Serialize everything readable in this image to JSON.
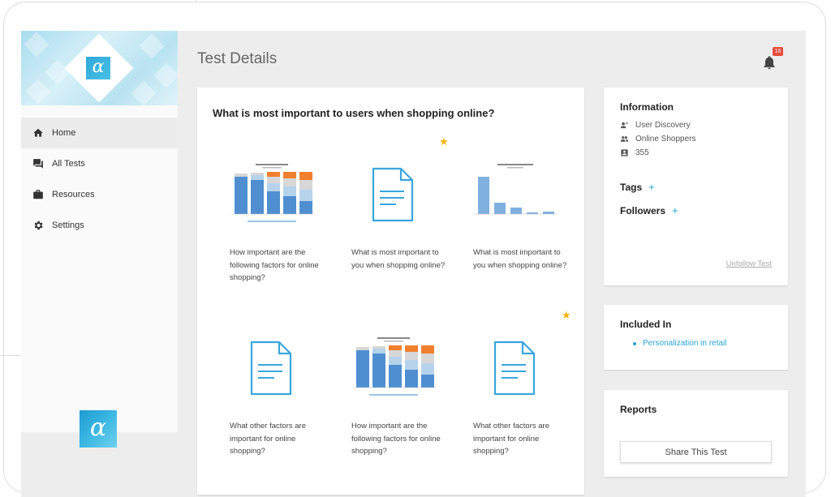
{
  "header": {
    "title": "Test Details",
    "notification_count": "16"
  },
  "sidebar": {
    "items": [
      {
        "label": "Home",
        "icon": "home-icon"
      },
      {
        "label": "All Tests",
        "icon": "chat-icon"
      },
      {
        "label": "Resources",
        "icon": "briefcase-icon"
      },
      {
        "label": "Settings",
        "icon": "gear-icon"
      }
    ],
    "logo_glyph": "α"
  },
  "main": {
    "question": "What is most important to users when shopping online?",
    "tiles": [
      {
        "caption": "How important are the following factors for online shopping?",
        "kind": "stacked-bar-chart",
        "starred": false
      },
      {
        "caption": "What is most important to you when shopping online?",
        "kind": "document",
        "starred": true
      },
      {
        "caption": "What is most important to you when shopping online?",
        "kind": "bar-chart",
        "starred": false
      },
      {
        "caption": "What other factors are important for online shopping?",
        "kind": "document",
        "starred": false
      },
      {
        "caption": "How important are the following factors for online shopping?",
        "kind": "stacked-bar-chart",
        "starred": true
      },
      {
        "caption": "What other factors are important for online shopping?",
        "kind": "document",
        "starred": false
      }
    ]
  },
  "information": {
    "title": "Information",
    "rows": [
      {
        "text": "User Discovery",
        "icon": "megaphone-user-icon"
      },
      {
        "text": "Online Shoppers",
        "icon": "people-icon"
      },
      {
        "text": "355",
        "icon": "id-badge-icon"
      }
    ],
    "tags_label": "Tags",
    "followers_label": "Followers",
    "unfollow_label": "Unfollow Test"
  },
  "included": {
    "title": "Included In",
    "items": [
      "Personalization in retail"
    ]
  },
  "reports": {
    "title": "Reports",
    "share_label": "Share This Test"
  },
  "colors": {
    "accent": "#2aa3d4",
    "doc_icon": "#3aa6dc",
    "star": "#f5b400",
    "badge": "#e84c3d"
  }
}
